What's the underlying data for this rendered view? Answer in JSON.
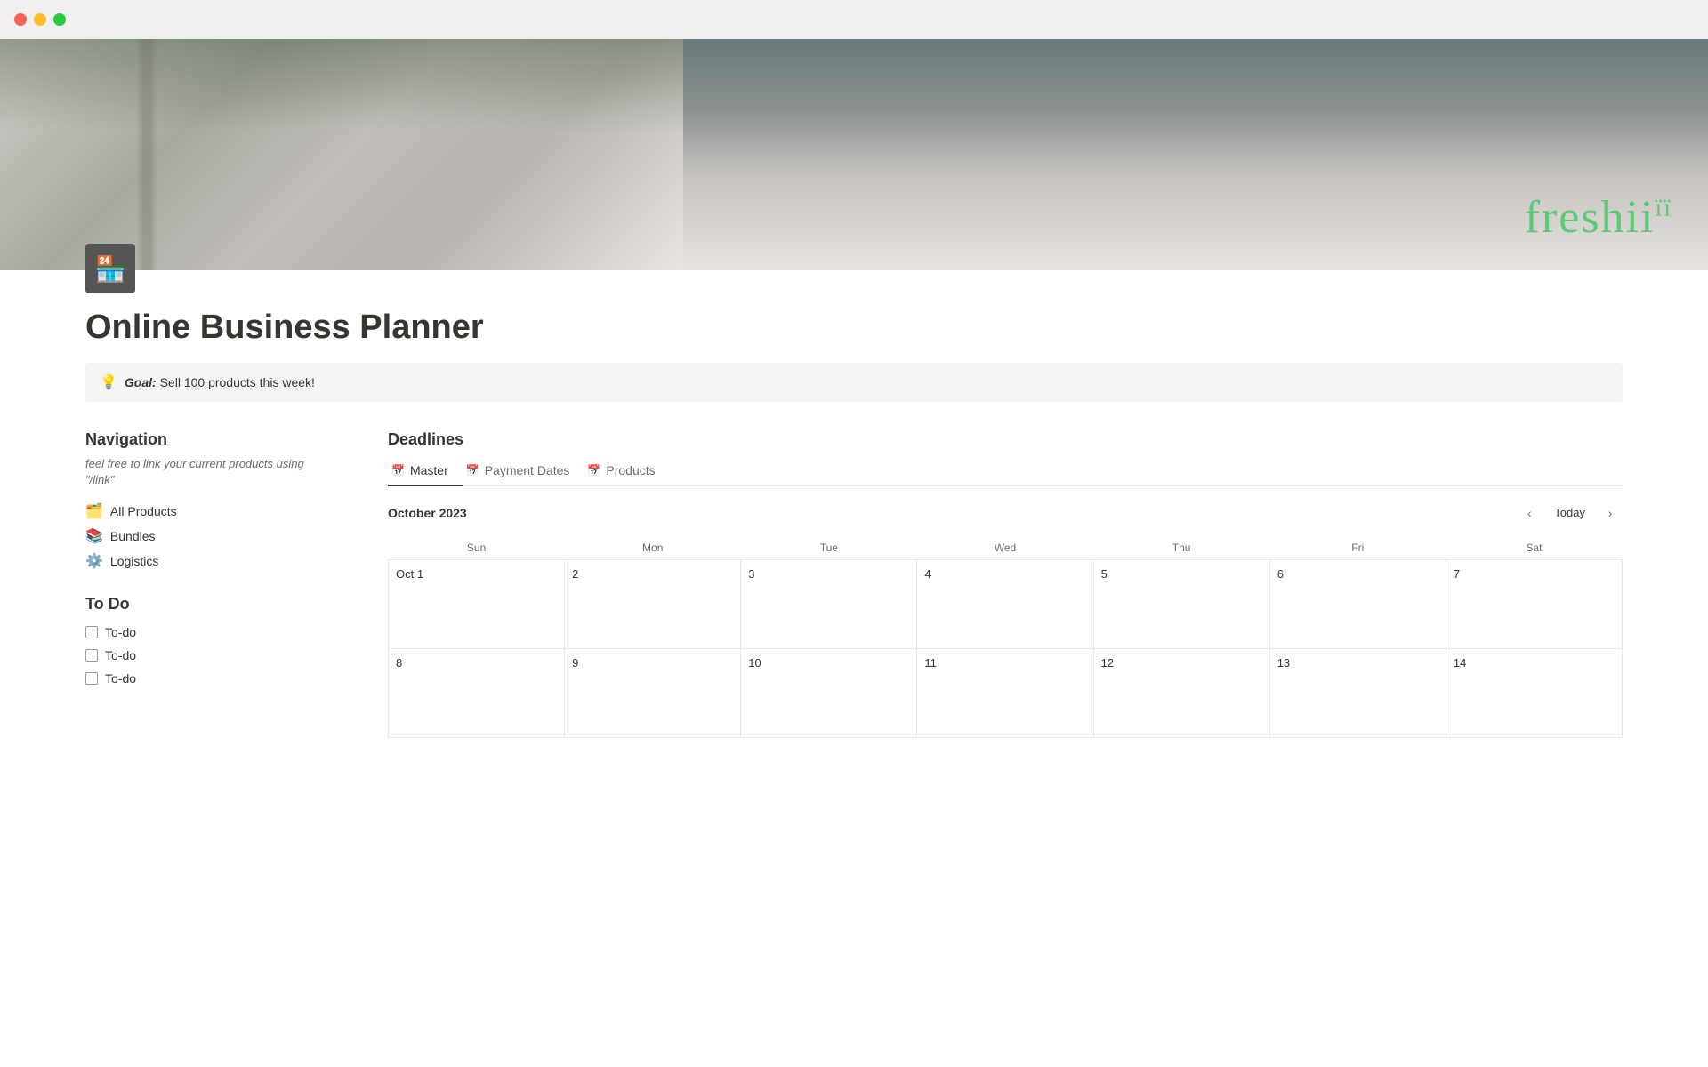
{
  "titlebar": {
    "traffic_lights": [
      "red",
      "yellow",
      "green"
    ]
  },
  "hero": {
    "freshii_text": "freshii"
  },
  "page_icon": "🏪",
  "page_title": "Online Business Planner",
  "goal_banner": {
    "icon": "💡",
    "label": "Goal:",
    "text": " Sell 100 products this week!"
  },
  "navigation": {
    "heading": "Navigation",
    "subtitle": "feel free to link your current products using \"/link\"",
    "items": [
      {
        "icon": "🗂️",
        "label": "All Products"
      },
      {
        "icon": "📚",
        "label": "Bundles"
      },
      {
        "icon": "⚙️",
        "label": "Logistics"
      }
    ]
  },
  "todo": {
    "heading": "To Do",
    "items": [
      {
        "label": "To-do",
        "checked": false
      },
      {
        "label": "To-do",
        "checked": false
      },
      {
        "label": "To-do",
        "checked": false
      }
    ]
  },
  "deadlines": {
    "heading": "Deadlines",
    "tabs": [
      {
        "icon": "📅",
        "label": "Master",
        "active": true
      },
      {
        "icon": "📅",
        "label": "Payment Dates",
        "active": false
      },
      {
        "icon": "📅",
        "label": "Products",
        "active": false
      }
    ],
    "calendar": {
      "month_label": "October 2023",
      "nav_today": "Today",
      "days_of_week": [
        "Sun",
        "Mon",
        "Tue",
        "Wed",
        "Thu",
        "Fri",
        "Sat"
      ],
      "weeks": [
        [
          {
            "day": "Oct 1",
            "events": []
          },
          {
            "day": "2",
            "events": []
          },
          {
            "day": "3",
            "events": []
          },
          {
            "day": "4",
            "events": []
          },
          {
            "day": "5",
            "events": []
          },
          {
            "day": "6",
            "events": []
          },
          {
            "day": "7",
            "events": []
          }
        ],
        [
          {
            "day": "8",
            "events": []
          },
          {
            "day": "9",
            "events": []
          },
          {
            "day": "10",
            "events": []
          },
          {
            "day": "11",
            "events": []
          },
          {
            "day": "12",
            "events": []
          },
          {
            "day": "13",
            "events": []
          },
          {
            "day": "14",
            "events": []
          }
        ]
      ]
    }
  }
}
